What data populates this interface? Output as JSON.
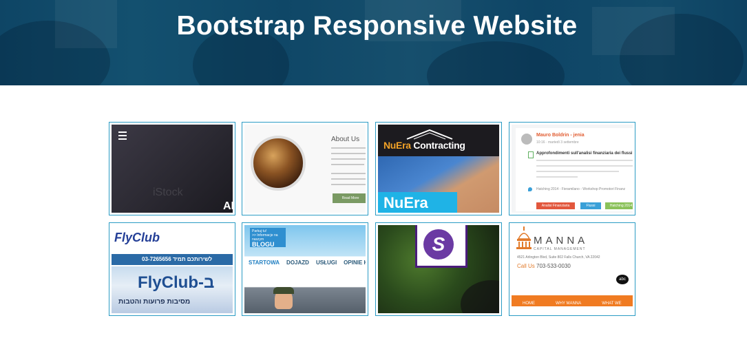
{
  "hero": {
    "title": "Bootstrap Responsive Website"
  },
  "gallery": {
    "tiles": [
      {
        "id": "t1",
        "watermark": "iStock",
        "corner_text": "AI"
      },
      {
        "id": "t2",
        "heading": "About Us",
        "button": "Read More"
      },
      {
        "id": "t3",
        "logo_main": "NuEra",
        "logo_sub": "Contracting",
        "banner": "NuEra"
      },
      {
        "id": "t4",
        "author": "Mauro Boldrin - jenia",
        "time": "10:16 · martedì 3 settembre",
        "post_title": "Approfondimenti sull'analisi finanziaria dei flussi",
        "event": "Hatching 2014 - Fieramilano - Workshop Promotori Finanz",
        "tags": [
          "Analisi Finanziaria",
          "Flussi",
          "Hatching 2014"
        ]
      },
      {
        "id": "t5",
        "logo": "FlyClub",
        "phone": "03-7265656 לשירותכם תמיד",
        "brand": "FlyClub-ב",
        "hebrew_line": "מסיבות פרועות והטבות"
      },
      {
        "id": "t6",
        "note_line1": "Parkuj tu!",
        "note_line2": ">> Informacje na naszym",
        "note_big": "BLOGU",
        "nav": [
          "STARTOWA",
          "DOJAZD",
          "USŁUGI",
          "OPINIE KLIENTÓW"
        ]
      },
      {
        "id": "t7",
        "badge": "S"
      },
      {
        "id": "t8",
        "brand": "MANNA",
        "tagline": "CAPITAL MANAGEMENT",
        "address": "4521 Arlington Blvd, Suite 802 Falls Church, VA 22042",
        "call_label": "Call Us",
        "call_number": "703-533-0030",
        "nav": [
          "HOME",
          "WHY MANNA",
          "WHAT WE"
        ],
        "abc": "abc"
      }
    ]
  }
}
